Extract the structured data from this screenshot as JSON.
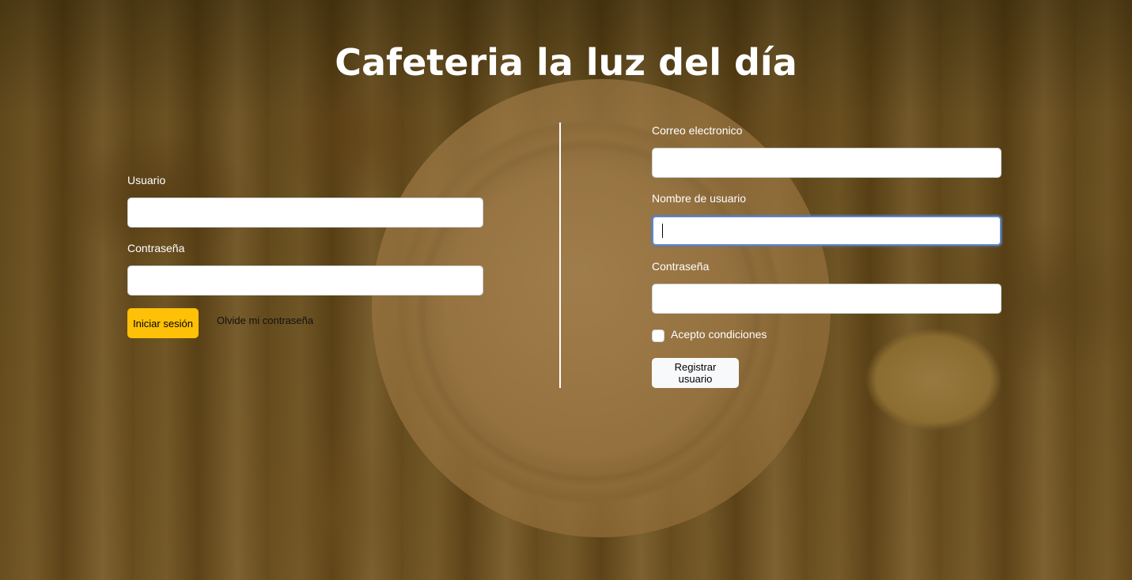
{
  "page": {
    "title": "Cafeteria la luz del día"
  },
  "login": {
    "username_label": "Usuario",
    "username_value": "",
    "password_label": "Contraseña",
    "password_value": "",
    "submit_label": "Iniciar sesión",
    "forgot_label": "Olvide mi contraseña"
  },
  "register": {
    "email_label": "Correo electronico",
    "email_value": "",
    "username_label": "Nombre de usuario",
    "username_value": "",
    "password_label": "Contraseña",
    "password_value": "",
    "terms_label": "Acepto condiciones",
    "terms_checked": false,
    "submit_label": "Registrar usuario"
  },
  "colors": {
    "primary_button": "#ffc107",
    "secondary_button": "#f8f9fa",
    "focus_border": "#5f87c7",
    "text_light": "#ffffff"
  }
}
